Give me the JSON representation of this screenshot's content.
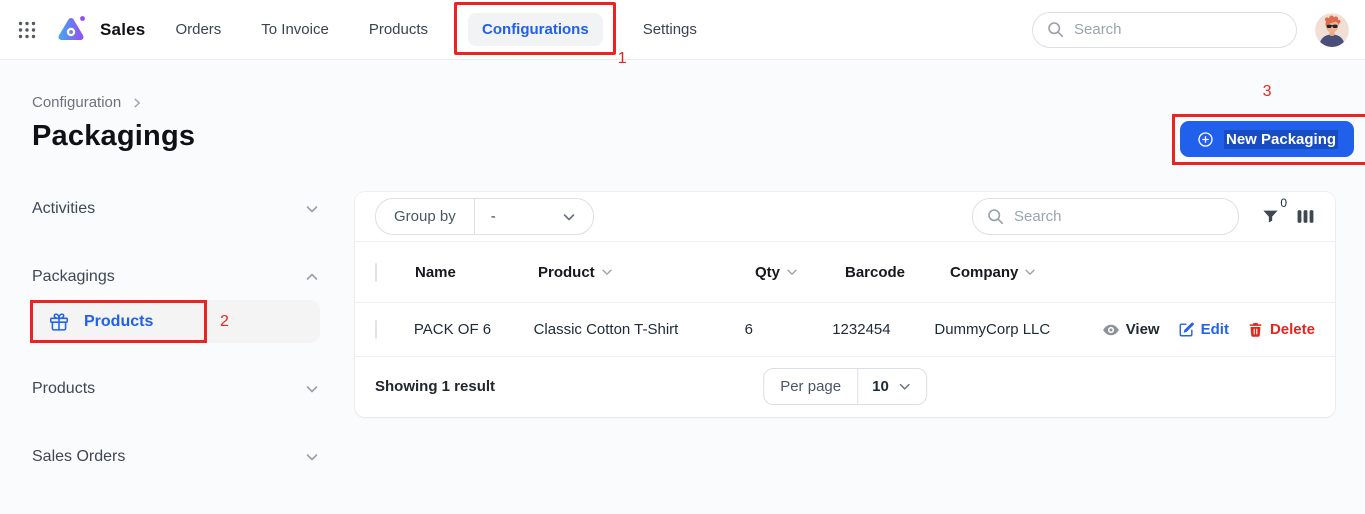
{
  "header": {
    "app_name": "Sales",
    "nav": [
      {
        "label": "Orders"
      },
      {
        "label": "To Invoice"
      },
      {
        "label": "Products"
      },
      {
        "label": "Configurations",
        "active": true
      },
      {
        "label": "Settings"
      }
    ],
    "search_placeholder": "Search"
  },
  "annotations": {
    "step1": "1",
    "step2": "2",
    "step3": "3"
  },
  "page": {
    "breadcrumb": "Configuration",
    "title": "Packagings",
    "new_button_label": "New Packaging"
  },
  "sidebar": {
    "sections": [
      {
        "label": "Activities",
        "expanded": false
      },
      {
        "label": "Packagings",
        "expanded": true
      },
      {
        "label": "Products",
        "expanded": false
      },
      {
        "label": "Sales Orders",
        "expanded": false
      }
    ],
    "packagings_items": [
      {
        "label": "Products",
        "icon": "gift-icon",
        "active": true
      }
    ]
  },
  "table": {
    "group_by_label": "Group by",
    "group_by_value": "-",
    "search_placeholder": "Search",
    "filter_count": "0",
    "columns": [
      {
        "label": "Name",
        "sortable": false
      },
      {
        "label": "Product",
        "sortable": true
      },
      {
        "label": "Qty",
        "sortable": true
      },
      {
        "label": "Barcode",
        "sortable": false
      },
      {
        "label": "Company",
        "sortable": true
      }
    ],
    "rows": [
      {
        "name": "PACK OF 6",
        "product": "Classic Cotton T-Shirt",
        "qty": "6",
        "barcode": "1232454",
        "company": "DummyCorp LLC"
      }
    ],
    "actions": {
      "view": "View",
      "edit": "Edit",
      "delete": "Delete"
    },
    "footer": {
      "showing": "Showing 1 result",
      "per_page_label": "Per page",
      "per_page_value": "10"
    }
  },
  "colors": {
    "accent_blue": "#2160ea",
    "edit_blue": "#2563eb",
    "delete_red": "#e8251d",
    "annotation_red": "#e9251f",
    "page_bg": "#fafbfc"
  }
}
